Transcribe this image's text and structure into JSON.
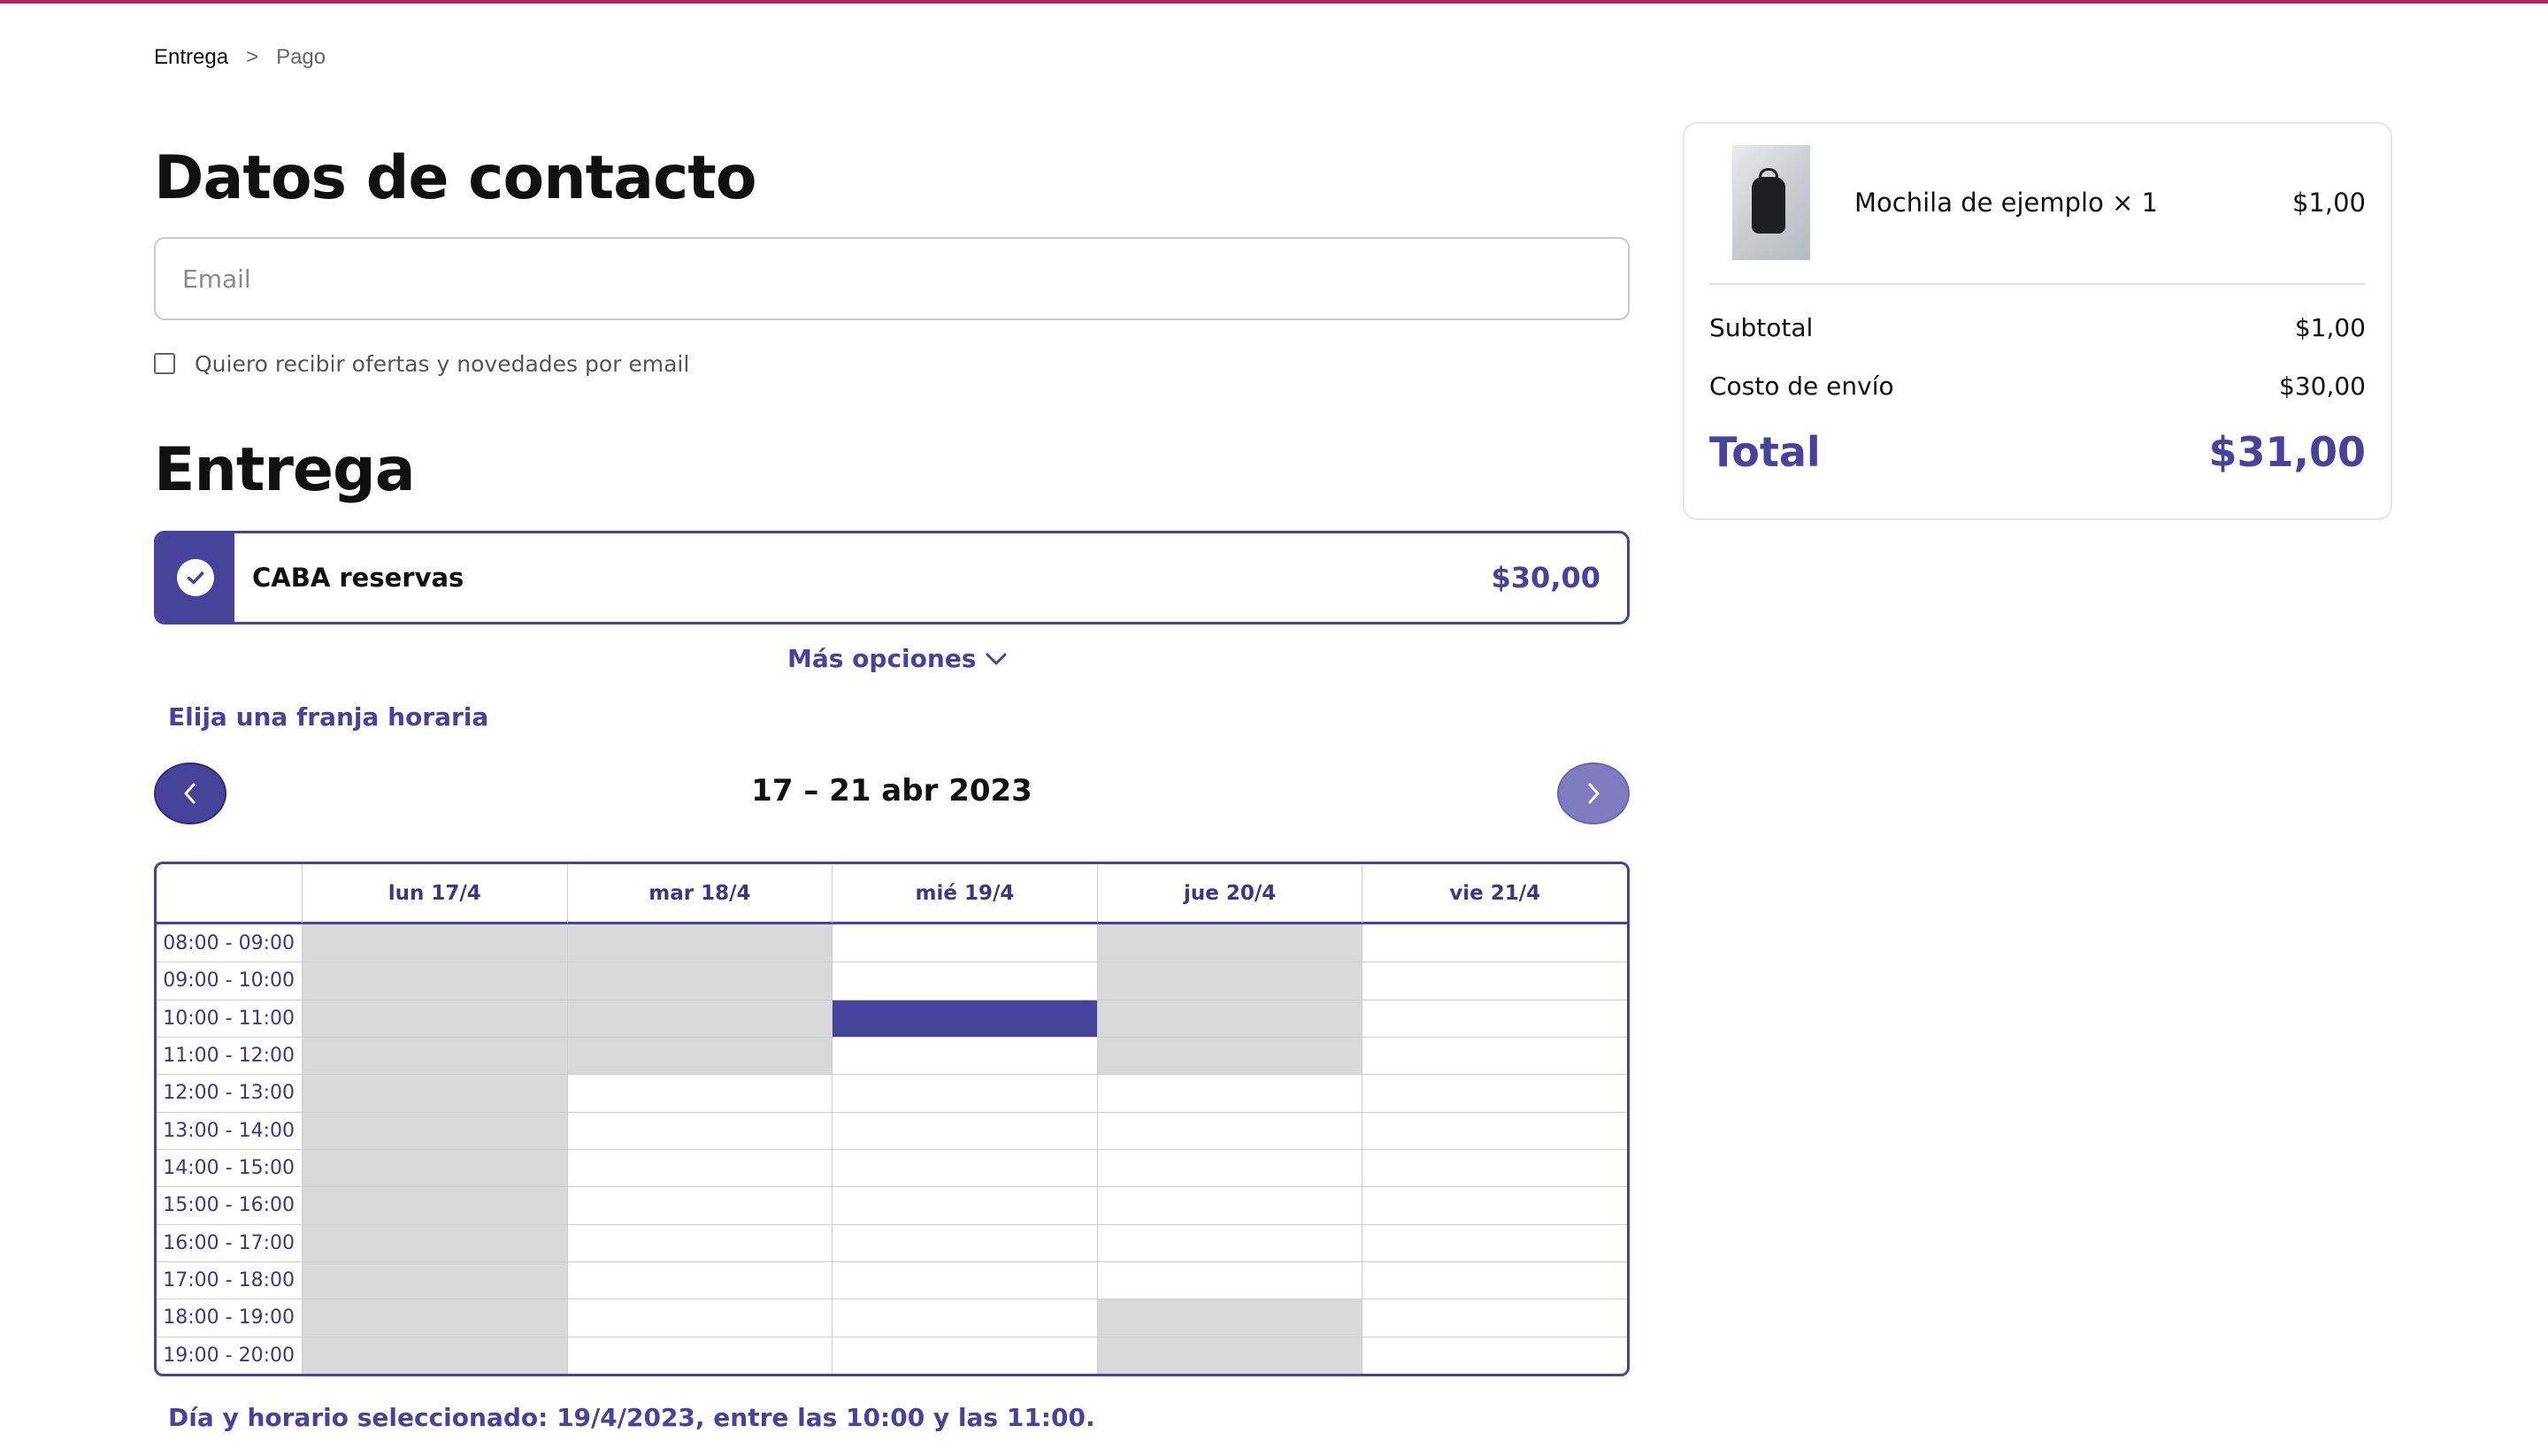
{
  "breadcrumb": {
    "step1": "Entrega",
    "separator": ">",
    "step2": "Pago"
  },
  "contact": {
    "title": "Datos de contacto",
    "email_placeholder": "Email",
    "email_value": "",
    "optin_label": "Quiero recibir ofertas y novedades por email",
    "optin_checked": false
  },
  "delivery": {
    "title": "Entrega",
    "option_name": "CABA reservas",
    "option_price": "$30,00",
    "more_options_label": "Más opciones",
    "slot_title": "Elija una franja horaria",
    "week_label": "17 – 21 abr 2023"
  },
  "calendar": {
    "days": [
      "lun 17/4",
      "mar 18/4",
      "mié 19/4",
      "jue 20/4",
      "vie 21/4"
    ],
    "times": [
      "08:00 - 09:00",
      "09:00 - 10:00",
      "10:00 - 11:00",
      "11:00 - 12:00",
      "12:00 - 13:00",
      "13:00 - 14:00",
      "14:00 - 15:00",
      "15:00 - 16:00",
      "16:00 - 17:00",
      "17:00 - 18:00",
      "18:00 - 19:00",
      "19:00 - 20:00"
    ],
    "unavailable": [
      [
        0,
        0
      ],
      [
        0,
        1
      ],
      [
        0,
        2
      ],
      [
        0,
        3
      ],
      [
        0,
        4
      ],
      [
        0,
        5
      ],
      [
        0,
        6
      ],
      [
        0,
        7
      ],
      [
        0,
        8
      ],
      [
        0,
        9
      ],
      [
        0,
        10
      ],
      [
        0,
        11
      ],
      [
        1,
        0
      ],
      [
        1,
        1
      ],
      [
        1,
        2
      ],
      [
        1,
        3
      ],
      [
        3,
        0
      ],
      [
        3,
        1
      ],
      [
        3,
        2
      ],
      [
        3,
        3
      ],
      [
        3,
        10
      ],
      [
        3,
        11
      ]
    ],
    "selected": [
      2,
      2
    ]
  },
  "selected_text": "Día y horario seleccionado: 19/4/2023, entre las 10:00 y las 11:00.",
  "summary": {
    "item_name": "Mochila de ejemplo × 1",
    "item_price": "$1,00",
    "subtotal_label": "Subtotal",
    "subtotal_value": "$1,00",
    "shipping_label": "Costo de envío",
    "shipping_value": "$30,00",
    "total_label": "Total",
    "total_value": "$31,00"
  },
  "colors": {
    "accent": "#47429a",
    "top_bar": "#b3265a",
    "unavailable": "#d8d8d8"
  }
}
